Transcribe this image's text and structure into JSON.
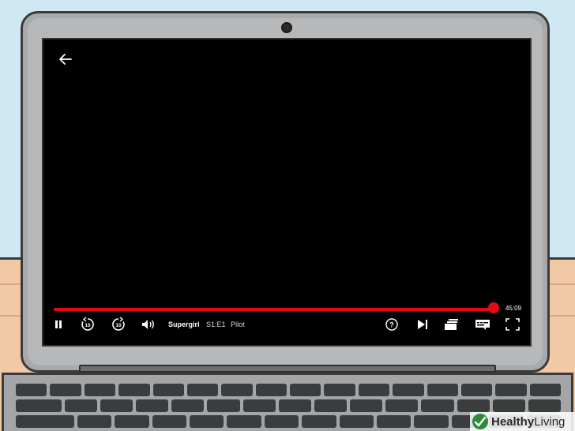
{
  "player": {
    "show_title": "Supergirl",
    "episode_code": "S1:E1",
    "episode_name": "Pilot",
    "time_remaining": "45:09",
    "progress_fraction": 0.995,
    "accent_color": "#e50914"
  },
  "icons": {
    "back": "back-arrow-icon",
    "pause": "pause-icon",
    "rewind": "rewind-10-icon",
    "forward": "forward-10-icon",
    "volume": "volume-icon",
    "help": "help-icon",
    "next": "next-episode-icon",
    "episodes": "episodes-icon",
    "subtitles": "subtitles-icon",
    "fullscreen": "fullscreen-icon"
  },
  "watermark": {
    "bold": "Healthy",
    "regular": "Living"
  }
}
